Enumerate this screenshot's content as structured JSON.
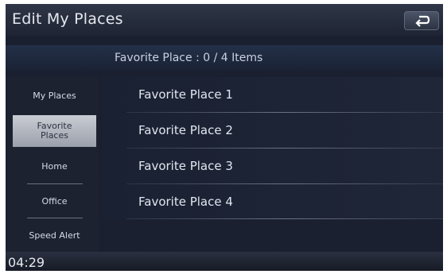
{
  "header": {
    "title": "Edit My Places"
  },
  "subheader": {
    "count_text": "Favorite Place : 0 / 4 Items"
  },
  "sidebar": {
    "items": [
      {
        "label": "My Places"
      },
      {
        "label": "Favorite\nPlaces"
      },
      {
        "label": "Home"
      },
      {
        "label": "Office"
      },
      {
        "label": "Speed Alert"
      }
    ],
    "active_index": 1
  },
  "list": {
    "items": [
      {
        "label": "Favorite Place 1"
      },
      {
        "label": "Favorite Place 2"
      },
      {
        "label": "Favorite Place 3"
      },
      {
        "label": "Favorite Place 4"
      }
    ]
  },
  "footer": {
    "clock": "04:29"
  },
  "icons": {
    "back": "back-arrow-icon"
  },
  "colors": {
    "background": "#1b2030",
    "text": "#e2e6ee",
    "active_tab": "#b4b8c1"
  }
}
